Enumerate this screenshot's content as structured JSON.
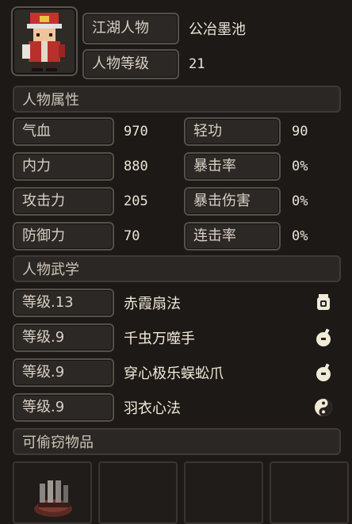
{
  "character": {
    "name_label": "江湖人物",
    "name_value": "公冶墨池",
    "level_label": "人物等级",
    "level_value": "21"
  },
  "sections": {
    "attributes": "人物属性",
    "martial_arts": "人物武学",
    "stealable": "可偷窃物品"
  },
  "attributes": [
    {
      "label": "气血",
      "value": "970"
    },
    {
      "label": "轻功",
      "value": "90"
    },
    {
      "label": "内力",
      "value": "880"
    },
    {
      "label": "暴击率",
      "value": "0%"
    },
    {
      "label": "攻击力",
      "value": "205"
    },
    {
      "label": "暴击伤害",
      "value": "0%"
    },
    {
      "label": "防御力",
      "value": "70"
    },
    {
      "label": "连击率",
      "value": "0%"
    }
  ],
  "skills": [
    {
      "level": "等级.13",
      "name": "赤霞扇法",
      "icon": "fan-icon"
    },
    {
      "level": "等级.9",
      "name": "千虫万噬手",
      "icon": "palm-icon"
    },
    {
      "level": "等级.9",
      "name": "穿心极乐蜈蚣爪",
      "icon": "palm-icon"
    },
    {
      "level": "等级.9",
      "name": "羽衣心法",
      "icon": "yin-yang-icon"
    }
  ],
  "items": [
    {
      "icon": "claw-glove-icon"
    },
    {
      "icon": ""
    },
    {
      "icon": ""
    },
    {
      "icon": ""
    }
  ],
  "colors": {
    "panel_bg": "#1c1916",
    "border": "#4a4540",
    "text": "#e6ddd0"
  }
}
